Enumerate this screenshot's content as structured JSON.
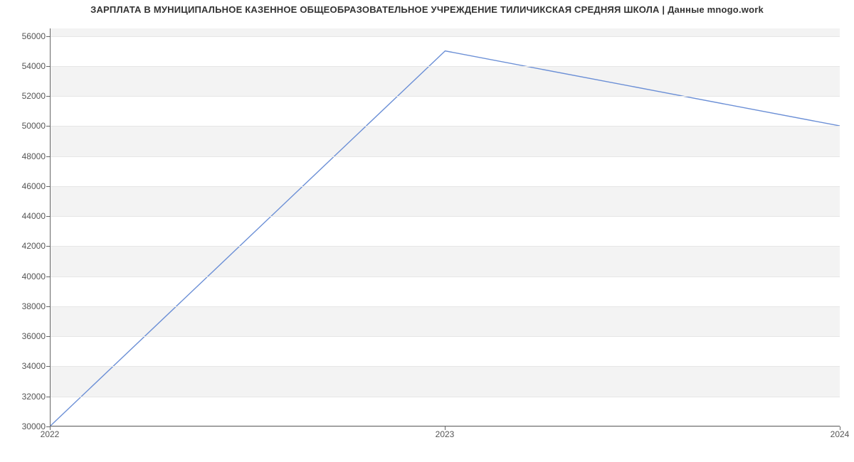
{
  "chart_data": {
    "type": "line",
    "title": "ЗАРПЛАТА В МУНИЦИПАЛЬНОЕ КАЗЕННОЕ ОБЩЕОБРАЗОВАТЕЛЬНОЕ УЧРЕЖДЕНИЕ ТИЛИЧИКСКАЯ СРЕДНЯЯ ШКОЛА | Данные mnogo.work",
    "x": [
      2022,
      2023,
      2024
    ],
    "values": [
      30000,
      55000,
      50000
    ],
    "x_ticks": [
      2022,
      2023,
      2024
    ],
    "y_ticks": [
      30000,
      32000,
      34000,
      36000,
      38000,
      40000,
      42000,
      44000,
      46000,
      48000,
      50000,
      52000,
      54000,
      56000
    ],
    "xlim": [
      2022,
      2024
    ],
    "ylim": [
      30000,
      56500
    ],
    "xlabel": "",
    "ylabel": "",
    "line_color": "#6b8fd6",
    "band_color": "#f3f3f3"
  }
}
